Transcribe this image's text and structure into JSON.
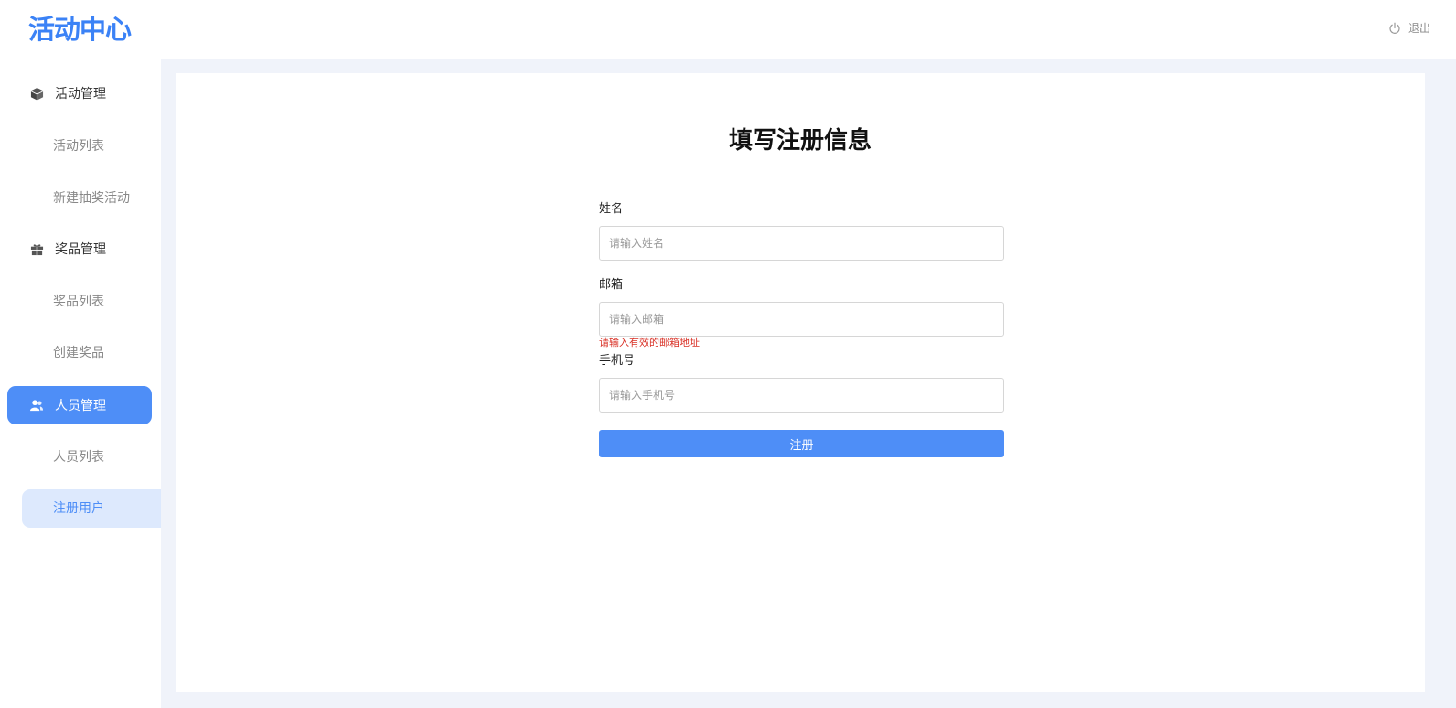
{
  "header": {
    "logo": "活动中心",
    "logout_label": "退出",
    "logout_icon": "power-icon"
  },
  "sidebar": {
    "groups": [
      {
        "label": "活动管理",
        "icon": "cube-icon",
        "items": [
          "活动列表",
          "新建抽奖活动"
        ]
      },
      {
        "label": "奖品管理",
        "icon": "gift-icon",
        "items": [
          "奖品列表",
          "创建奖品"
        ]
      },
      {
        "label": "人员管理",
        "icon": "users-icon",
        "items": [
          "人员列表",
          "注册用户"
        ]
      }
    ],
    "active_group": "人员管理",
    "active_item": "注册用户"
  },
  "form": {
    "title": "填写注册信息",
    "name_label": "姓名",
    "name_placeholder": "请输入姓名",
    "name_value": "",
    "email_label": "邮箱",
    "email_placeholder": "请输入邮箱",
    "email_value": "",
    "email_error": "请输入有效的邮箱地址",
    "phone_label": "手机号",
    "phone_placeholder": "请输入手机号",
    "phone_value": "",
    "submit_label": "注册"
  },
  "colors": {
    "brand": "#3b82f6",
    "accent": "#4e8ef7",
    "active_sub_bg": "#dde9fd",
    "error": "#d93025",
    "content_bg": "#f0f3fa"
  }
}
